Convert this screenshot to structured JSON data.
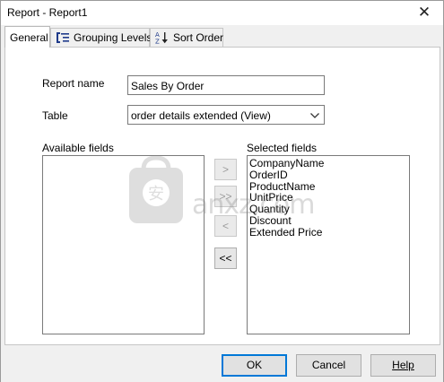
{
  "window": {
    "title": "Report - Report1",
    "close_glyph": "✕"
  },
  "tabs": [
    {
      "label": "General",
      "icon": null,
      "active": true
    },
    {
      "label": "Grouping Levels",
      "icon": "grouping-levels-icon",
      "active": false
    },
    {
      "label": "Sort Order",
      "icon": "sort-az-icon",
      "active": false
    }
  ],
  "form": {
    "report_name_label": "Report name",
    "report_name_value": "Sales By Order",
    "table_label": "Table",
    "table_value": "order details extended (View)",
    "available_fields_label": "Available fields",
    "selected_fields_label": "Selected fields",
    "available_fields": [],
    "selected_fields": [
      "CompanyName",
      "OrderID",
      "ProductName",
      "UnitPrice",
      "Quantity",
      "Discount",
      "Extended Price"
    ]
  },
  "transfer_buttons": {
    "add": ">",
    "add_all": ">>",
    "remove": "<",
    "remove_all": "<<"
  },
  "footer": {
    "ok": "OK",
    "cancel": "Cancel",
    "help": "Help"
  },
  "watermark": {
    "text": "anxz.com",
    "glyph": "安"
  },
  "colors": {
    "focus_border": "#0078d7",
    "window_bg": "#f0f0f0",
    "panel_bg": "#ffffff"
  }
}
